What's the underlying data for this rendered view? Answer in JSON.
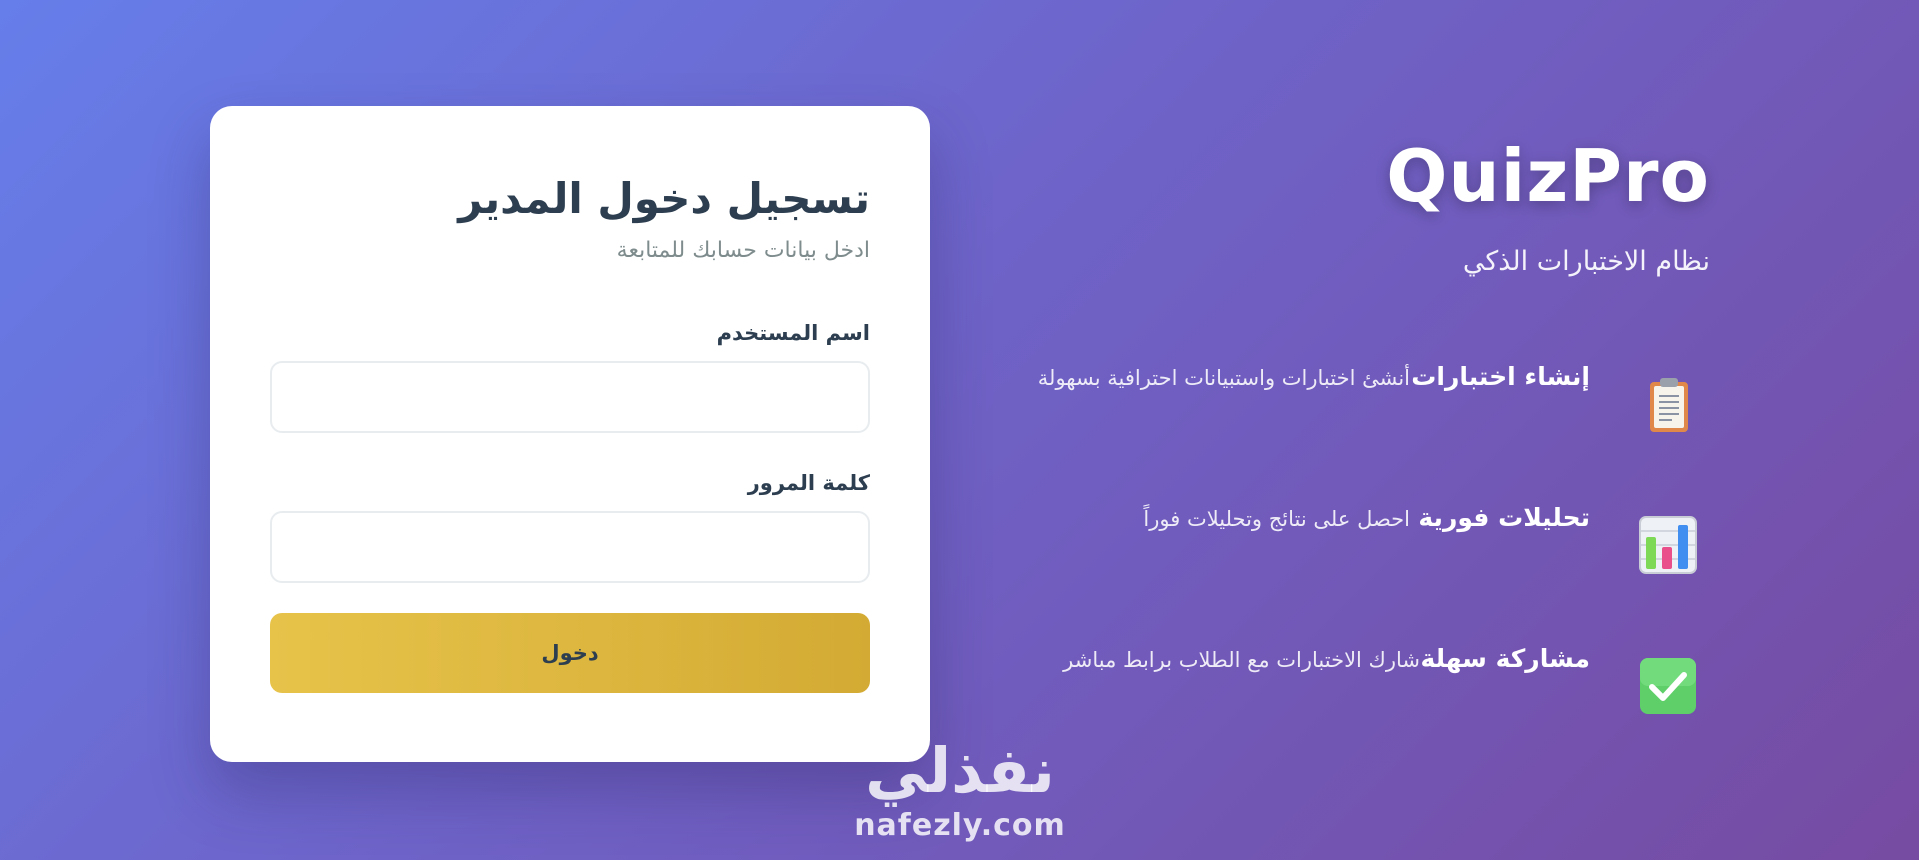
{
  "login": {
    "title": "تسجيل دخول المدير",
    "subtitle": "ادخل بيانات حسابك للمتابعة",
    "username_label": "اسم المستخدم",
    "username_value": "",
    "password_label": "كلمة المرور",
    "password_value": "",
    "submit_label": "دخول"
  },
  "hero": {
    "brand": "QuizPro",
    "tagline": "نظام الاختبارات الذكي",
    "features": [
      {
        "icon": "clipboard-icon",
        "title": "إنشاء اختبارات",
        "description": "أنشئ اختبارات واستبيانات احترافية بسهولة"
      },
      {
        "icon": "bar-chart-icon",
        "title": "تحليلات فورية",
        "description": "احصل على نتائج وتحليلات فوراً"
      },
      {
        "icon": "check-box-icon",
        "title": "مشاركة سهلة",
        "description": "شارك الاختبارات مع الطلاب برابط مباشر"
      }
    ]
  },
  "watermark": {
    "arabic": "نفذلي",
    "latin": "nafezly.com"
  },
  "colors": {
    "background_start": "#667eea",
    "background_end": "#764ba2",
    "button_gold": "#e2bc44",
    "text_dark": "#2c3e50"
  }
}
